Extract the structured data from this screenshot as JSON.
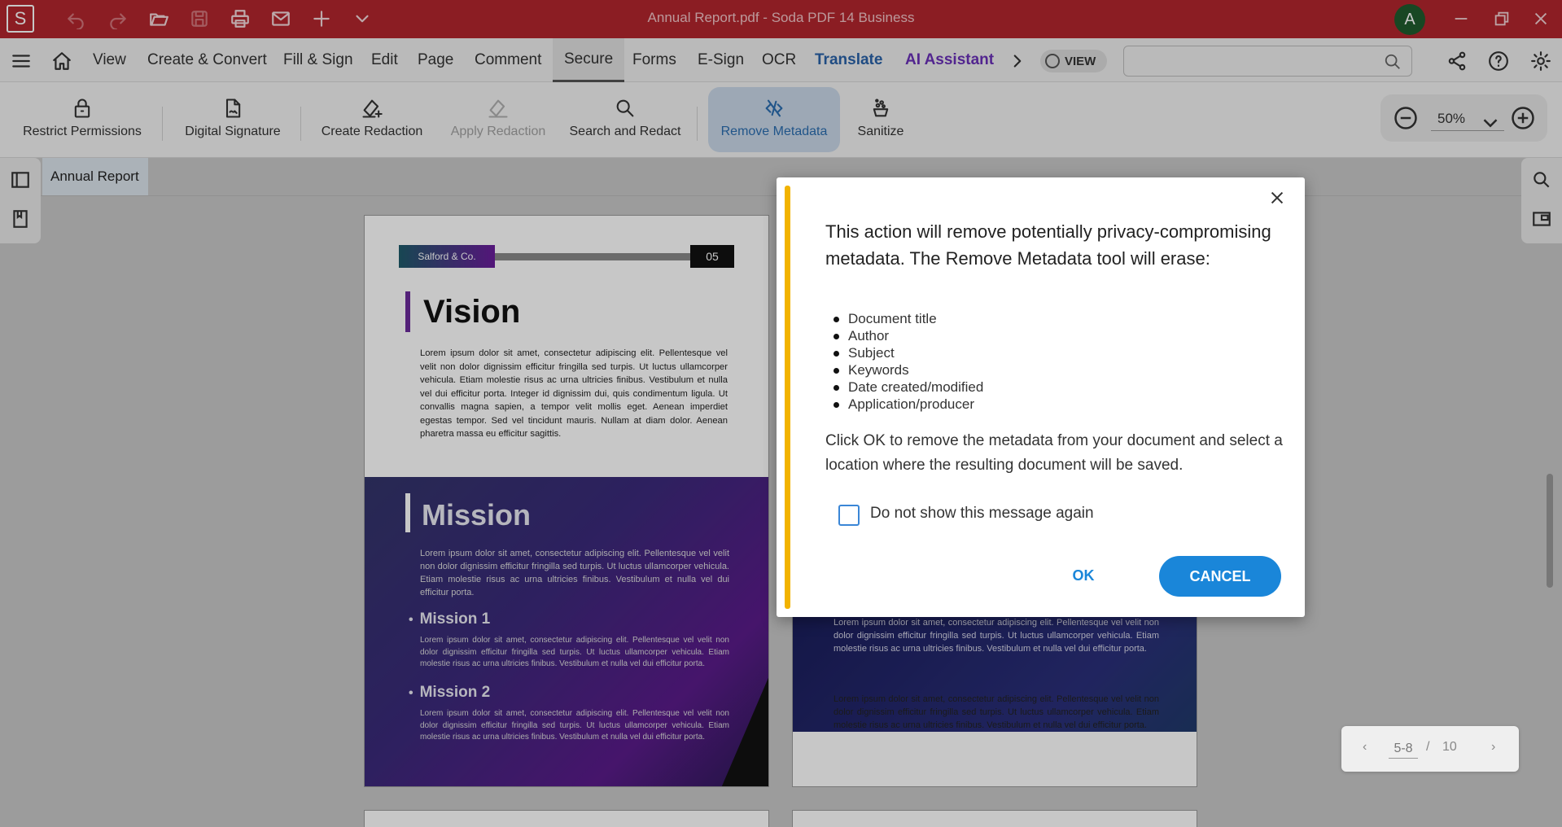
{
  "window": {
    "title": "Annual Report.pdf   -   Soda PDF 14 Business",
    "app_logo": "S",
    "avatar_letter": "A"
  },
  "menu": {
    "items": [
      "View",
      "Create & Convert",
      "Fill & Sign",
      "Edit",
      "Page",
      "Comment",
      "Secure",
      "Forms",
      "E-Sign",
      "OCR",
      "Translate",
      "AI Assistant"
    ],
    "active": "Secure",
    "view_toggle": "VIEW",
    "search_placeholder": ""
  },
  "ribbon": {
    "buttons": [
      {
        "label": "Restrict Permissions",
        "icon": "lock-icon"
      },
      {
        "label": "Digital Signature",
        "icon": "signature-file-icon"
      },
      {
        "label": "Create Redaction",
        "icon": "redaction-create-icon"
      },
      {
        "label": "Apply Redaction",
        "icon": "redaction-apply-icon",
        "disabled": true
      },
      {
        "label": "Search and Redact",
        "icon": "search-icon"
      },
      {
        "label": "Remove Metadata",
        "icon": "remove-metadata-icon",
        "selected": true
      },
      {
        "label": "Sanitize",
        "icon": "sanitize-icon"
      }
    ],
    "zoom": "50%"
  },
  "document": {
    "tab_name": "Annual Report",
    "left_page": {
      "brand": "Salford & Co.",
      "page_number": "05",
      "vision_title": "Vision",
      "vision_text": "Lorem ipsum dolor sit amet, consectetur adipiscing elit. Pellentesque vel velit non dolor dignissim efficitur fringilla sed turpis. Ut luctus ullamcorper vehicula. Etiam molestie risus ac urna ultricies finibus. Vestibulum et nulla vel dui efficitur porta. Integer id dignissim dui, quis condimentum ligula. Ut convallis magna sapien, a tempor velit mollis eget. Aenean imperdiet egestas tempor. Sed vel tincidunt mauris. Nullam at diam dolor. Aenean pharetra massa eu efficitur sagittis.",
      "mission_title": "Mission",
      "mission_text": "Lorem ipsum dolor sit amet, consectetur adipiscing elit. Pellentesque vel velit non dolor dignissim efficitur fringilla sed turpis. Ut luctus ullamcorper vehicula. Etiam molestie risus ac urna ultricies finibus. Vestibulum et nulla vel dui efficitur porta.",
      "mission1_title": "Mission 1",
      "mission1_text": "Lorem ipsum dolor sit amet, consectetur adipiscing elit. Pellentesque vel velit non dolor dignissim efficitur fringilla sed turpis. Ut luctus ullamcorper vehicula. Etiam molestie risus ac urna ultricies finibus. Vestibulum et nulla vel dui efficitur porta.",
      "mission2_title": "Mission 2",
      "mission2_text": "Lorem ipsum dolor sit amet, consectetur adipiscing elit. Pellentesque vel velit non dolor dignissim efficitur fringilla sed turpis. Ut luctus ullamcorper vehicula. Etiam molestie risus ac urna ultricies finibus. Vestibulum et nulla vel dui efficitur porta."
    },
    "right_page": {
      "text1": "Lorem ipsum dolor sit amet, consectetur adipiscing elit. Pellentesque vel velit non dolor dignissim efficitur fringilla sed turpis. Ut luctus ullamcorper vehicula. Etiam molestie risus ac urna ultricies finibus. Vestibulum et nulla vel dui efficitur porta.",
      "text2": "Lorem ipsum dolor sit amet, consectetur adipiscing elit. Pellentesque vel velit non dolor dignissim efficitur fringilla sed turpis. Ut luctus ullamcorper vehicula. Etiam molestie risus ac urna ultricies finibus. Vestibulum et nulla vel dui efficitur porta."
    },
    "page_nav": {
      "current": "5-8",
      "separator": "/",
      "total": "10"
    }
  },
  "dialog": {
    "heading": "This action will remove potentially privacy-compromising metadata. The Remove Metadata tool will erase:",
    "items": [
      "Document title",
      "Author",
      "Subject",
      "Keywords",
      "Date created/modified",
      "Application/producer"
    ],
    "body": "Click OK to remove the metadata from your document and select a location where the resulting document will be saved.",
    "checkbox_label": "Do not show this message again",
    "ok_label": "OK",
    "cancel_label": "CANCEL"
  },
  "colors": {
    "titlebar": "#b3262e",
    "accent_blue": "#1a86d9",
    "dialog_accent": "#f2b300",
    "translate": "#2a62a8",
    "ai_assistant": "#6a30b8"
  }
}
